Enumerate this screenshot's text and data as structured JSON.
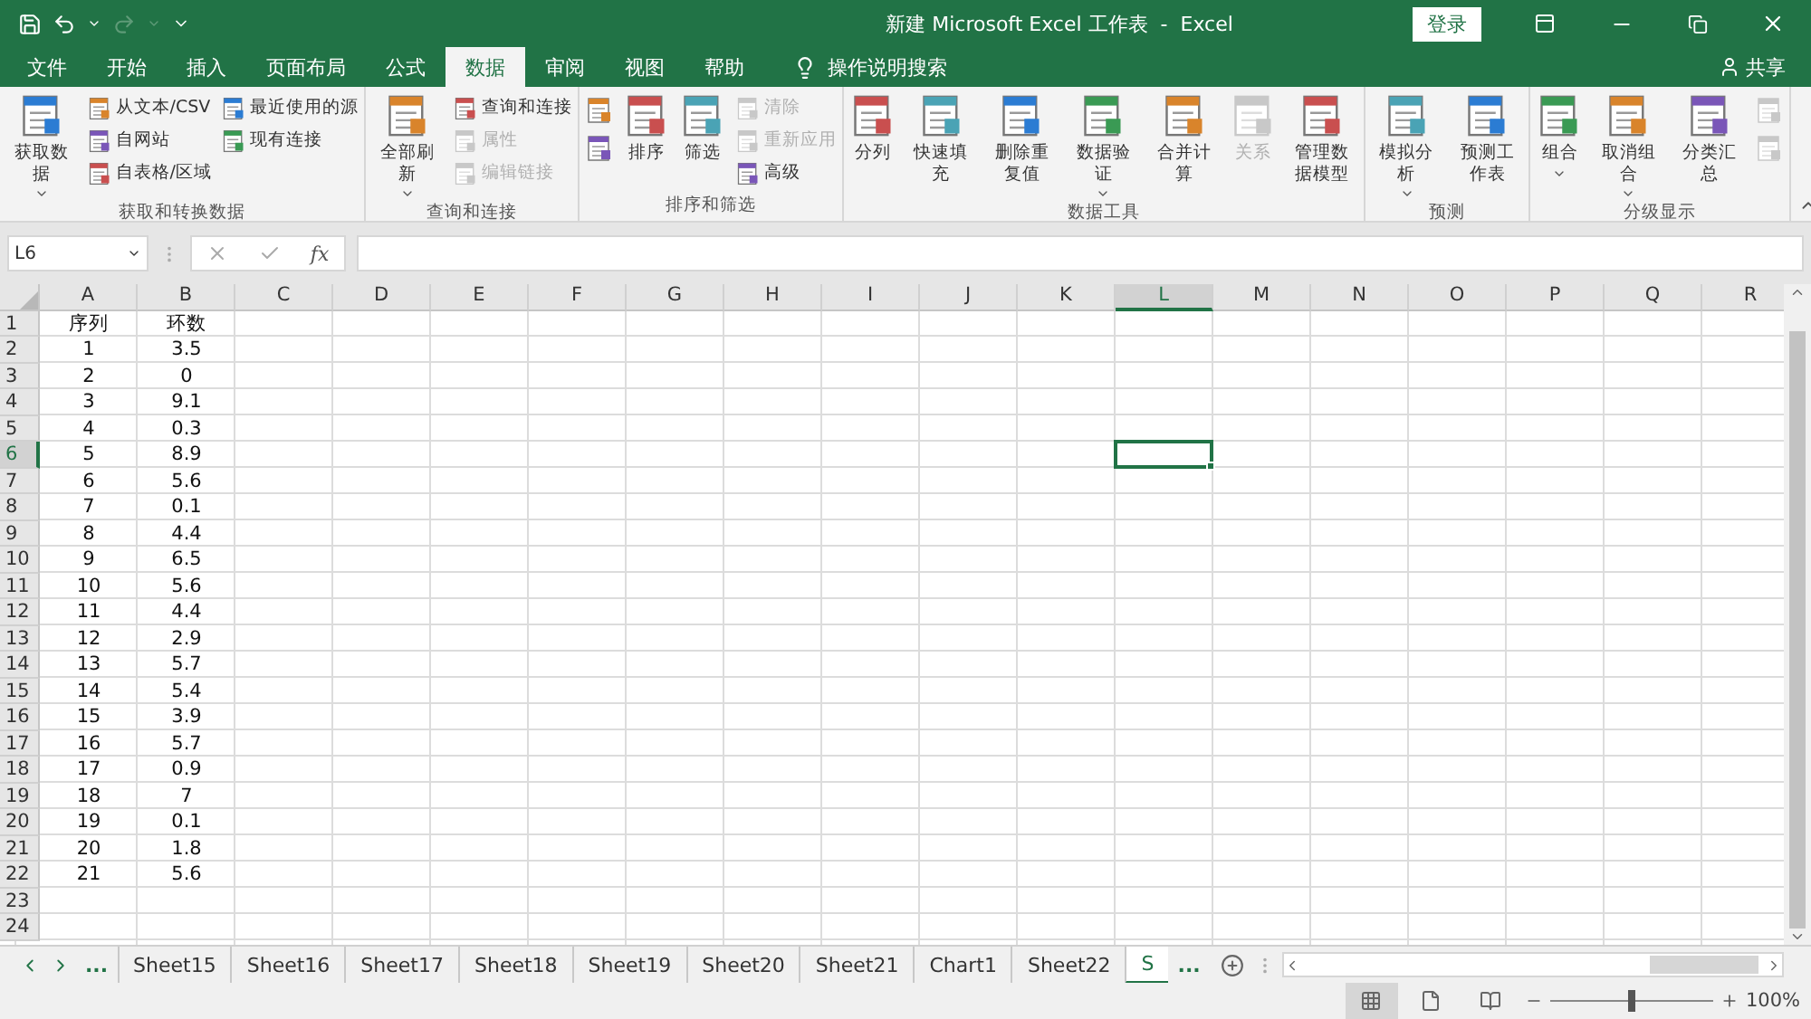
{
  "title_bar": {
    "title": "新建 Microsoft Excel 工作表  -  Excel",
    "login": "登录"
  },
  "ribbon_tabs": [
    {
      "label": "文件",
      "selected": false
    },
    {
      "label": "开始",
      "selected": false
    },
    {
      "label": "插入",
      "selected": false
    },
    {
      "label": "页面布局",
      "selected": false
    },
    {
      "label": "公式",
      "selected": false
    },
    {
      "label": "数据",
      "selected": true
    },
    {
      "label": "审阅",
      "selected": false
    },
    {
      "label": "视图",
      "selected": false
    },
    {
      "label": "帮助",
      "selected": false
    }
  ],
  "tell_me": "操作说明搜索",
  "share": "共享",
  "ribbon_groups": [
    {
      "label": "获取和转换数据",
      "items": [
        {
          "kind": "large",
          "label": "获取数据",
          "dropdown": true,
          "disabled": false
        },
        {
          "kind": "stack",
          "items": [
            {
              "kind": "small",
              "label": "从文本/CSV",
              "disabled": false
            },
            {
              "kind": "small",
              "label": "自网站",
              "disabled": false
            },
            {
              "kind": "small",
              "label": "自表格/区域",
              "disabled": false
            }
          ]
        },
        {
          "kind": "stack",
          "items": [
            {
              "kind": "small",
              "label": "最近使用的源",
              "disabled": false
            },
            {
              "kind": "small",
              "label": "现有连接",
              "disabled": false
            }
          ]
        }
      ]
    },
    {
      "label": "查询和连接",
      "items": [
        {
          "kind": "large",
          "label": "全部刷新",
          "dropdown": true,
          "disabled": false
        },
        {
          "kind": "stack",
          "items": [
            {
              "kind": "small",
              "label": "查询和连接",
              "disabled": false
            },
            {
              "kind": "small",
              "label": "属性",
              "disabled": true
            },
            {
              "kind": "small",
              "label": "编辑链接",
              "disabled": true
            }
          ]
        }
      ]
    },
    {
      "label": "排序和筛选",
      "items": [
        {
          "kind": "stack",
          "items": [
            {
              "kind": "icon",
              "disabled": false
            },
            {
              "kind": "icon",
              "disabled": false
            }
          ]
        },
        {
          "kind": "large",
          "label": "排序",
          "dropdown": false,
          "disabled": false
        },
        {
          "kind": "large",
          "label": "筛选",
          "dropdown": false,
          "disabled": false
        },
        {
          "kind": "stack",
          "items": [
            {
              "kind": "small",
              "label": "清除",
              "disabled": true
            },
            {
              "kind": "small",
              "label": "重新应用",
              "disabled": true
            },
            {
              "kind": "small",
              "label": "高级",
              "disabled": false
            }
          ]
        }
      ]
    },
    {
      "label": "数据工具",
      "items": [
        {
          "kind": "large",
          "label": "分列",
          "dropdown": false,
          "disabled": false
        },
        {
          "kind": "large",
          "label": "快速填充",
          "dropdown": false,
          "disabled": false
        },
        {
          "kind": "large",
          "label": "删除重复值",
          "dropdown": false,
          "disabled": false
        },
        {
          "kind": "large",
          "label": "数据验证",
          "dropdown": true,
          "disabled": false
        },
        {
          "kind": "large",
          "label": "合并计算",
          "dropdown": false,
          "disabled": false
        },
        {
          "kind": "large",
          "label": "关系",
          "dropdown": false,
          "disabled": true
        },
        {
          "kind": "large",
          "label": "管理数据模型",
          "dropdown": false,
          "disabled": false
        }
      ]
    },
    {
      "label": "预测",
      "items": [
        {
          "kind": "large",
          "label": "模拟分析",
          "dropdown": true,
          "disabled": false
        },
        {
          "kind": "large",
          "label": "预测工作表",
          "dropdown": false,
          "disabled": false
        }
      ]
    },
    {
      "label": "分级显示",
      "items": [
        {
          "kind": "large",
          "label": "组合",
          "dropdown": true,
          "disabled": false
        },
        {
          "kind": "large",
          "label": "取消组合",
          "dropdown": true,
          "disabled": false
        },
        {
          "kind": "large",
          "label": "分类汇总",
          "dropdown": false,
          "disabled": false
        },
        {
          "kind": "stack",
          "items": [
            {
              "kind": "icon",
              "disabled": true
            },
            {
              "kind": "icon",
              "disabled": true
            }
          ]
        }
      ]
    }
  ],
  "name_box": "L6",
  "function_button": "fx",
  "columns": [
    {
      "label": "A",
      "selected": false
    },
    {
      "label": "B",
      "selected": false
    },
    {
      "label": "C",
      "selected": false
    },
    {
      "label": "D",
      "selected": false
    },
    {
      "label": "E",
      "selected": false
    },
    {
      "label": "F",
      "selected": false
    },
    {
      "label": "G",
      "selected": false
    },
    {
      "label": "H",
      "selected": false
    },
    {
      "label": "I",
      "selected": false
    },
    {
      "label": "J",
      "selected": false
    },
    {
      "label": "K",
      "selected": false
    },
    {
      "label": "L",
      "selected": true
    },
    {
      "label": "M",
      "selected": false
    },
    {
      "label": "N",
      "selected": false
    },
    {
      "label": "O",
      "selected": false
    },
    {
      "label": "P",
      "selected": false
    },
    {
      "label": "Q",
      "selected": false
    },
    {
      "label": "R",
      "selected": false
    }
  ],
  "rows": [
    {
      "label": "1",
      "selected": false,
      "cells": [
        "序列",
        "环数"
      ]
    },
    {
      "label": "2",
      "selected": false,
      "cells": [
        "1",
        "3.5"
      ]
    },
    {
      "label": "3",
      "selected": false,
      "cells": [
        "2",
        "0"
      ]
    },
    {
      "label": "4",
      "selected": false,
      "cells": [
        "3",
        "9.1"
      ]
    },
    {
      "label": "5",
      "selected": false,
      "cells": [
        "4",
        "0.3"
      ]
    },
    {
      "label": "6",
      "selected": true,
      "cells": [
        "5",
        "8.9"
      ]
    },
    {
      "label": "7",
      "selected": false,
      "cells": [
        "6",
        "5.6"
      ]
    },
    {
      "label": "8",
      "selected": false,
      "cells": [
        "7",
        "0.1"
      ]
    },
    {
      "label": "9",
      "selected": false,
      "cells": [
        "8",
        "4.4"
      ]
    },
    {
      "label": "10",
      "selected": false,
      "cells": [
        "9",
        "6.5"
      ]
    },
    {
      "label": "11",
      "selected": false,
      "cells": [
        "10",
        "5.6"
      ]
    },
    {
      "label": "12",
      "selected": false,
      "cells": [
        "11",
        "4.4"
      ]
    },
    {
      "label": "13",
      "selected": false,
      "cells": [
        "12",
        "2.9"
      ]
    },
    {
      "label": "14",
      "selected": false,
      "cells": [
        "13",
        "5.7"
      ]
    },
    {
      "label": "15",
      "selected": false,
      "cells": [
        "14",
        "5.4"
      ]
    },
    {
      "label": "16",
      "selected": false,
      "cells": [
        "15",
        "3.9"
      ]
    },
    {
      "label": "17",
      "selected": false,
      "cells": [
        "16",
        "5.7"
      ]
    },
    {
      "label": "18",
      "selected": false,
      "cells": [
        "17",
        "0.9"
      ]
    },
    {
      "label": "19",
      "selected": false,
      "cells": [
        "18",
        "7"
      ]
    },
    {
      "label": "20",
      "selected": false,
      "cells": [
        "19",
        "0.1"
      ]
    },
    {
      "label": "21",
      "selected": false,
      "cells": [
        "20",
        "1.8"
      ]
    },
    {
      "label": "22",
      "selected": false,
      "cells": [
        "21",
        "5.6"
      ]
    },
    {
      "label": "23",
      "selected": false,
      "cells": []
    },
    {
      "label": "24",
      "selected": false,
      "cells": []
    }
  ],
  "sheet_more_left": "...",
  "sheet_tabs": [
    {
      "label": "Sheet15",
      "selected": false
    },
    {
      "label": "Sheet16",
      "selected": false
    },
    {
      "label": "Sheet17",
      "selected": false
    },
    {
      "label": "Sheet18",
      "selected": false
    },
    {
      "label": "Sheet19",
      "selected": false
    },
    {
      "label": "Sheet20",
      "selected": false
    },
    {
      "label": "Sheet21",
      "selected": false
    },
    {
      "label": "Chart1",
      "selected": false
    },
    {
      "label": "Sheet22",
      "selected": false
    },
    {
      "label": "S",
      "selected": true
    }
  ],
  "sheet_more_right": "...",
  "status_bar": {
    "views": [
      {
        "selected": true
      },
      {
        "selected": false
      },
      {
        "selected": false
      }
    ],
    "zoom": {
      "level": 0.5,
      "reading": "100%"
    }
  }
}
